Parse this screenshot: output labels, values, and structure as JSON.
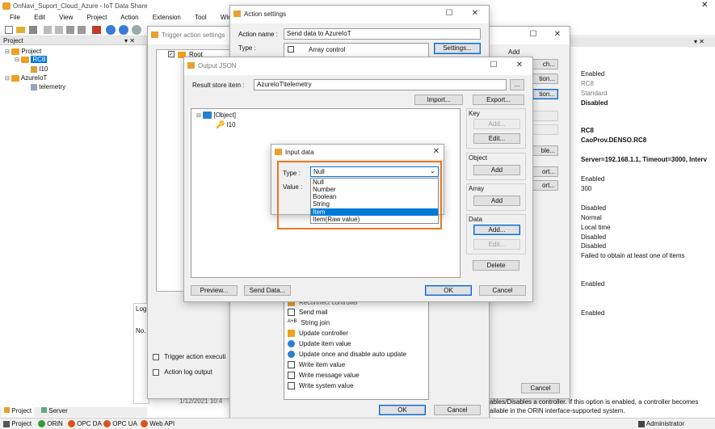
{
  "main_window": {
    "title": "OnNavi_Suport_Cloud_Azure - IoT Data Share",
    "menu": [
      "File",
      "Edit",
      "View",
      "Project",
      "Action",
      "Extension",
      "Tool",
      "Window"
    ]
  },
  "project_panel": {
    "title": "Project",
    "panel_pin": "▾ ✕",
    "tree": {
      "root": "Project",
      "rc8": "RC8",
      "i10": "I10",
      "azure": "AzureIoT",
      "telemetry": "telemetry"
    }
  },
  "log_panel": {
    "tab_short": "Log",
    "col_short": "No."
  },
  "bottom_tabs": {
    "project": "Project",
    "server": "Server"
  },
  "status_bar": {
    "project": "Project",
    "orin": "ORiN",
    "opcda": "OPC DA",
    "opcua": "OPC UA",
    "webapi": "Web API",
    "admin": "Administrator",
    "date_fragment": "1/12/2021 10:4"
  },
  "properties": {
    "values": [
      "Enabled",
      "RC8",
      "Standard",
      "Disabled",
      "RC8",
      "CaoProv.DENSO.RC8",
      "Server=192.168.1.1, Timeout=3000, Interv",
      "Enabled",
      "300",
      "Disabled",
      "Normal",
      "Local time",
      "Disabled",
      "Disabled",
      "Failed to obtain at least one of items",
      "Enabled",
      "Enabled"
    ],
    "description": "ables/Disables a controller. If this option is enabled, a controller becomes ailable in the ORiN interface-supported system."
  },
  "trigger_window": {
    "title": "Trigger action settings",
    "root_item": "Root",
    "trigger_exec_label": "Trigger action executi",
    "action_log_label": "Action log output",
    "right_labels": [
      "Add",
      "ch...",
      "tion...",
      "tion..."
    ],
    "partial_buttons": [
      "ble...",
      "ort...",
      "ort..."
    ],
    "cancel": "Cancel"
  },
  "action_window": {
    "title": "Action settings",
    "action_name_label": "Action name :",
    "action_name_value": "Send data to AzureIoT",
    "type_label": "Type :",
    "type_value": "Array control",
    "settings_button": "Settings...",
    "action_list": [
      "Reconnect controller",
      "Send mail",
      "String join",
      "Update controller",
      "Update item value",
      "Update once and disable auto update",
      "Write item value",
      "Write message value",
      "Write system value"
    ],
    "ok": "OK",
    "cancel": "Cancel"
  },
  "output_window": {
    "title": "Output JSON",
    "result_label": "Result store item :",
    "result_value": "AzureIoT\\telemetry",
    "browse": "...",
    "import": "Import...",
    "export": "Export...",
    "tree_object": "[Object]",
    "tree_item": "I10",
    "key_group": "Key",
    "key_add": "Add...",
    "key_edit": "Edit...",
    "object_group": "Object",
    "object_add": "Add",
    "array_group": "Array",
    "array_add": "Add",
    "data_group": "Data",
    "data_add": "Add...",
    "data_edit": "Edit...",
    "delete": "Delete",
    "preview": "Preview...",
    "send_data": "Send Data...",
    "ok": "OK",
    "cancel": "Cancel"
  },
  "input_dialog": {
    "title": "Input data",
    "type_label": "Type :",
    "value_label": "Value :",
    "selected": "Null",
    "options": [
      "Null",
      "Number",
      "Boolean",
      "String",
      "Item",
      "Item(Raw value)"
    ],
    "highlighted_index": 4
  },
  "colors": {
    "highlight": "#0078d7",
    "callout": "#e87722",
    "title_text": "#222222"
  }
}
